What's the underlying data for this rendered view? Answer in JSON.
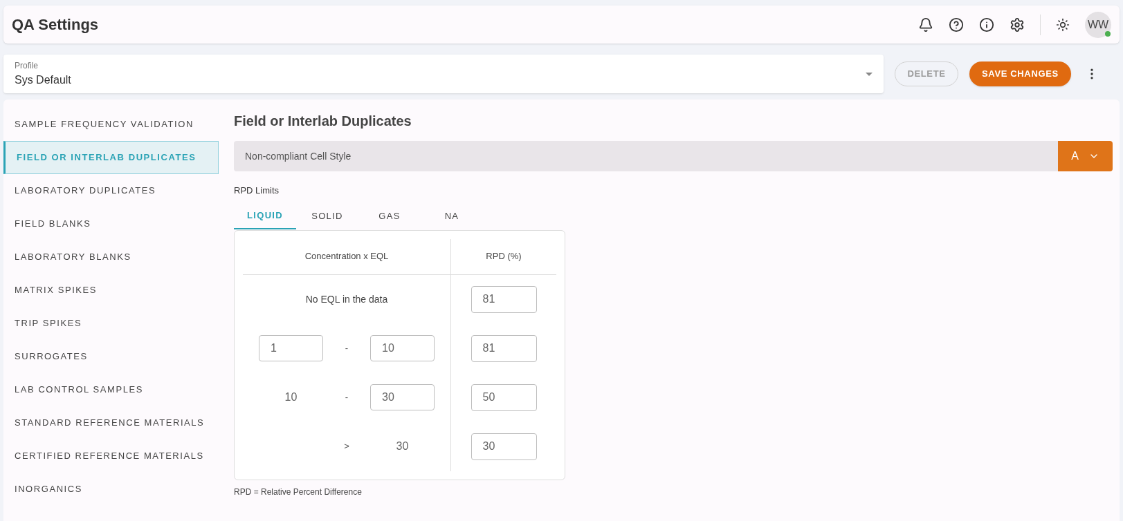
{
  "header": {
    "title": "QA Settings",
    "avatar": {
      "initials": "WW",
      "online": true
    }
  },
  "profile": {
    "label": "Profile",
    "value": "Sys Default"
  },
  "actions": {
    "delete": {
      "label": "DELETE",
      "disabled": true
    },
    "save": {
      "label": "SAVE CHANGES",
      "disabled": false
    }
  },
  "sidebar": {
    "items": [
      {
        "label": "SAMPLE FREQUENCY VALIDATION",
        "selected": false
      },
      {
        "label": "FIELD OR INTERLAB DUPLICATES",
        "selected": true
      },
      {
        "label": "LABORATORY DUPLICATES",
        "selected": false
      },
      {
        "label": "FIELD BLANKS",
        "selected": false
      },
      {
        "label": "LABORATORY BLANKS",
        "selected": false
      },
      {
        "label": "MATRIX SPIKES",
        "selected": false
      },
      {
        "label": "TRIP SPIKES",
        "selected": false
      },
      {
        "label": "SURROGATES",
        "selected": false
      },
      {
        "label": "LAB CONTROL SAMPLES",
        "selected": false
      },
      {
        "label": "STANDARD REFERENCE MATERIALS",
        "selected": false
      },
      {
        "label": "CERTIFIED REFERENCE MATERIALS",
        "selected": false
      },
      {
        "label": "INORGANICS",
        "selected": false
      }
    ]
  },
  "section": {
    "title": "Field or Interlab Duplicates",
    "cell_style": {
      "label": "Non-compliant Cell Style",
      "value": "A"
    },
    "rpd_label": "RPD Limits",
    "tabs": [
      {
        "label": "LIQUID",
        "selected": true
      },
      {
        "label": "SOLID",
        "selected": false
      },
      {
        "label": "GAS",
        "selected": false
      },
      {
        "label": "NA",
        "selected": false
      }
    ],
    "table": {
      "columns": [
        "Concentration x EQL",
        "RPD (%)"
      ],
      "rows": [
        {
          "kind": "note",
          "text": "No EQL in the data",
          "rpd": "81"
        },
        {
          "kind": "range",
          "lower": {
            "kind": "input",
            "value": "1"
          },
          "separator": "-",
          "upper": {
            "kind": "input",
            "value": "10"
          },
          "rpd": "81"
        },
        {
          "kind": "range",
          "lower": {
            "kind": "text",
            "value": "10"
          },
          "separator": "-",
          "upper": {
            "kind": "input",
            "value": "30"
          },
          "rpd": "50"
        },
        {
          "kind": "range",
          "separator": ">",
          "upper": {
            "kind": "text",
            "value": "30"
          },
          "rpd": "30"
        }
      ]
    },
    "footnote": "RPD = Relative Percent Difference"
  }
}
